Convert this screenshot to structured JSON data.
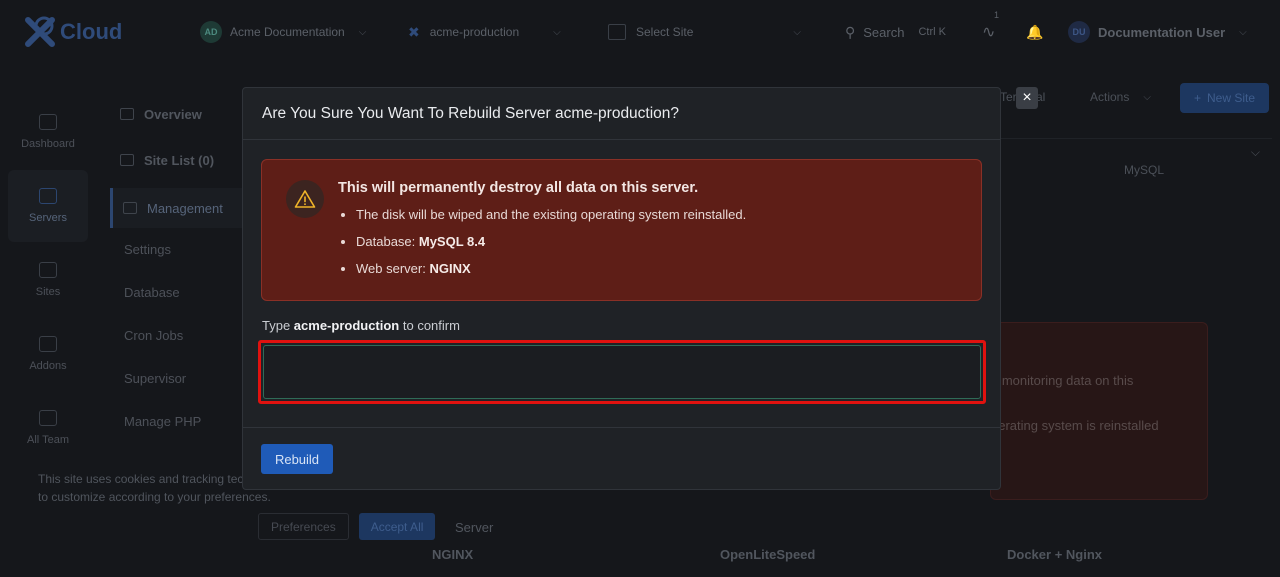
{
  "topbar": {
    "brand": "Cloud",
    "org": {
      "initials": "AD",
      "label": "Acme Documentation"
    },
    "server": {
      "label": "acme-production"
    },
    "site": {
      "placeholder": "Select Site"
    },
    "search": {
      "label": "Search",
      "shortcut": "Ctrl K"
    },
    "activity_count": "1",
    "user": {
      "initials": "DU",
      "name": "Documentation User"
    }
  },
  "sidebar": {
    "items": [
      {
        "label": "Dashboard"
      },
      {
        "label": "Servers"
      },
      {
        "label": "Sites"
      },
      {
        "label": "Addons"
      },
      {
        "label": "All Team"
      }
    ]
  },
  "subnav": {
    "overview": "Overview",
    "site_list": "Site List (0)",
    "management": "Management",
    "items": [
      "Settings",
      "Database",
      "Cron Jobs",
      "Supervisor",
      "Manage PHP"
    ]
  },
  "header_actions": {
    "terminal": "Terminal",
    "actions": "Actions",
    "new_site": "New Site"
  },
  "background": {
    "db_badge": "MySQL",
    "warn_line1": "d monitoring data on this",
    "warn_line2": "perating system is reinstalled",
    "section_heading": "Server",
    "cards": [
      "NGINX",
      "OpenLiteSpeed",
      "Docker + Nginx"
    ]
  },
  "cookie": {
    "text": "This site uses cookies and tracking technologies to customize according to your preferences.",
    "preferences": "Preferences",
    "accept_all": "Accept All"
  },
  "modal": {
    "title": "Are You Sure You Want To Rebuild Server acme-production?",
    "close": "×",
    "danger_title": "This will permanently destroy all data on this server.",
    "bullet1": "The disk will be wiped and the existing operating system reinstalled.",
    "bullet2_label": "Database: ",
    "bullet2_value": "MySQL 8.4",
    "bullet3_label": "Web server: ",
    "bullet3_value": "NGINX",
    "confirm_prefix": "Type ",
    "confirm_name": "acme-production",
    "confirm_suffix": " to confirm",
    "confirm_value": "",
    "confirm_placeholder": "",
    "rebuild": "Rebuild"
  },
  "colors": {
    "danger_bg": "#5e1e17",
    "danger_border": "#8a3026",
    "primary": "#1f5bb8",
    "highlight": "#e0120f"
  }
}
